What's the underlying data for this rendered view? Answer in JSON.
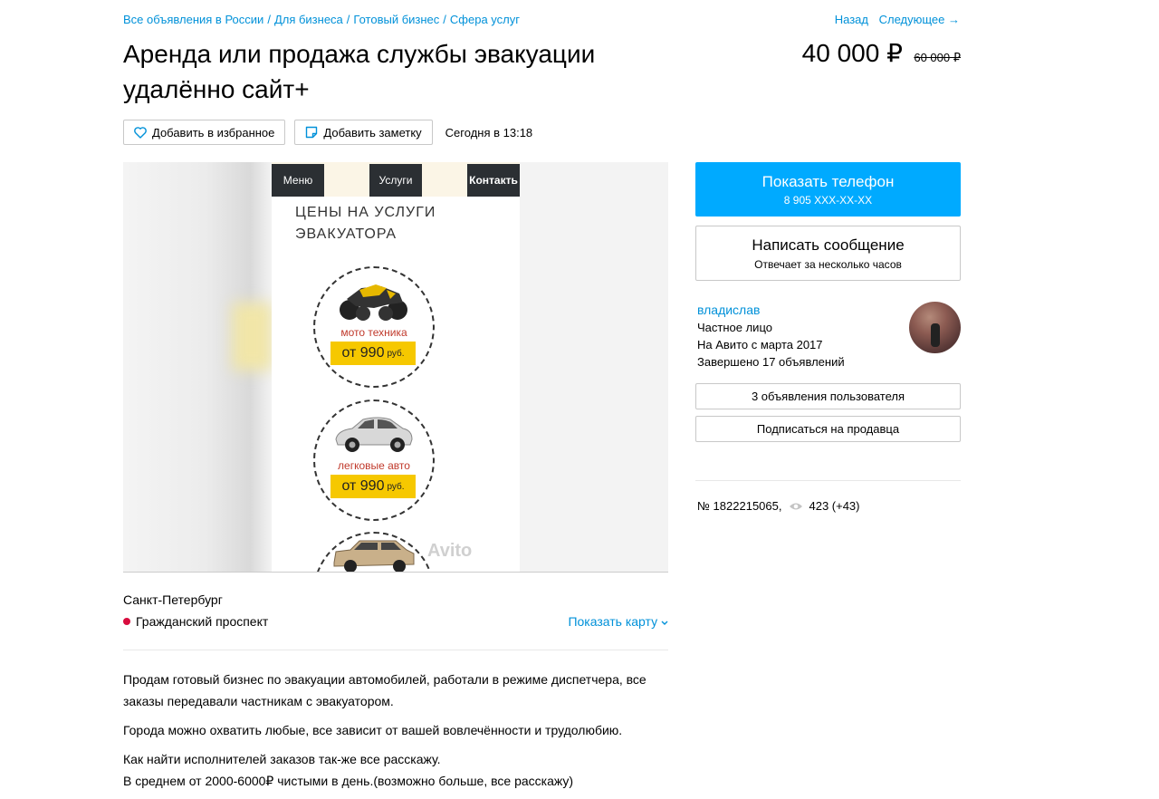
{
  "breadcrumbs": [
    "Все объявления в России",
    "Для бизнеса",
    "Готовый бизнес",
    "Сфера услуг"
  ],
  "nav": {
    "back": "Назад",
    "next": "Следующее →"
  },
  "title": "Аренда или продажа службы эвакуации удалённо сайт+",
  "price": {
    "current": "40 000 ₽",
    "old": "60 000 ₽"
  },
  "actions": {
    "favorite": "Добавить в избранное",
    "note": "Добавить заметку",
    "date": "Сегодня в 13:18"
  },
  "image": {
    "menu_tabs": [
      "Меню",
      "Услуги",
      "Контакть"
    ],
    "heading_line1": "ЦЕНЫ НА УСЛУГИ",
    "heading_line2": "ЭВАКУАТОРА",
    "services": [
      {
        "label": "мото техника",
        "price": "от 990",
        "unit": "руб."
      },
      {
        "label": "легковые авто",
        "price": "от 990",
        "unit": "руб."
      }
    ],
    "watermark": "Avito"
  },
  "location": {
    "city": "Санкт-Петербург",
    "metro": "Гражданский проспект",
    "show_map": "Показать карту"
  },
  "description": [
    "Продам готовый бизнес по эвакуации автомобилей, работали в режиме диспетчера, все заказы передавали частникам с эвакуатором.",
    "Города можно охватить любые, все зависит от вашей вовлечённости и трудолюбию.",
    "Как найти исполнителей заказов так-же все расскажу.",
    "В среднем от 2000-6000₽ чистыми в день.(возможно больше, все расскажу)"
  ],
  "contact": {
    "phone_button": "Показать телефон",
    "phone_masked": "8 905 XXX-XX-XX",
    "message_button": "Написать сообщение",
    "message_sub": "Отвечает за несколько часов"
  },
  "seller": {
    "name": "владислав",
    "type": "Частное лицо",
    "since": "На Авито с марта 2017",
    "completed": "Завершено 17 объявлений",
    "listings_button": "3 объявления пользователя",
    "subscribe_button": "Подписаться на продавца"
  },
  "meta": {
    "id": "№ 1822215065,",
    "views": "423 (+43)"
  }
}
